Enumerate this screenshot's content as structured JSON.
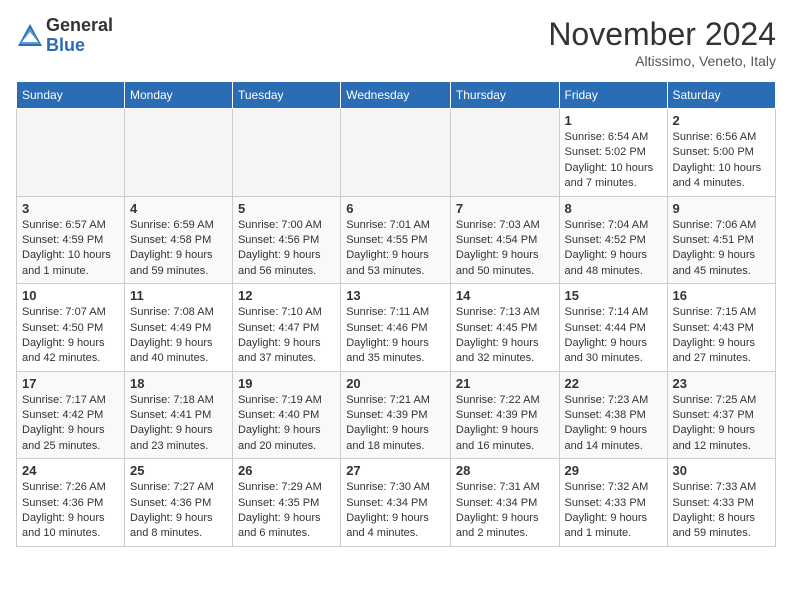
{
  "header": {
    "logo_line1": "General",
    "logo_line2": "Blue",
    "month_title": "November 2024",
    "subtitle": "Altissimo, Veneto, Italy"
  },
  "weekdays": [
    "Sunday",
    "Monday",
    "Tuesday",
    "Wednesday",
    "Thursday",
    "Friday",
    "Saturday"
  ],
  "weeks": [
    [
      {
        "day": "",
        "info": ""
      },
      {
        "day": "",
        "info": ""
      },
      {
        "day": "",
        "info": ""
      },
      {
        "day": "",
        "info": ""
      },
      {
        "day": "",
        "info": ""
      },
      {
        "day": "1",
        "info": "Sunrise: 6:54 AM\nSunset: 5:02 PM\nDaylight: 10 hours and 7 minutes."
      },
      {
        "day": "2",
        "info": "Sunrise: 6:56 AM\nSunset: 5:00 PM\nDaylight: 10 hours and 4 minutes."
      }
    ],
    [
      {
        "day": "3",
        "info": "Sunrise: 6:57 AM\nSunset: 4:59 PM\nDaylight: 10 hours and 1 minute."
      },
      {
        "day": "4",
        "info": "Sunrise: 6:59 AM\nSunset: 4:58 PM\nDaylight: 9 hours and 59 minutes."
      },
      {
        "day": "5",
        "info": "Sunrise: 7:00 AM\nSunset: 4:56 PM\nDaylight: 9 hours and 56 minutes."
      },
      {
        "day": "6",
        "info": "Sunrise: 7:01 AM\nSunset: 4:55 PM\nDaylight: 9 hours and 53 minutes."
      },
      {
        "day": "7",
        "info": "Sunrise: 7:03 AM\nSunset: 4:54 PM\nDaylight: 9 hours and 50 minutes."
      },
      {
        "day": "8",
        "info": "Sunrise: 7:04 AM\nSunset: 4:52 PM\nDaylight: 9 hours and 48 minutes."
      },
      {
        "day": "9",
        "info": "Sunrise: 7:06 AM\nSunset: 4:51 PM\nDaylight: 9 hours and 45 minutes."
      }
    ],
    [
      {
        "day": "10",
        "info": "Sunrise: 7:07 AM\nSunset: 4:50 PM\nDaylight: 9 hours and 42 minutes."
      },
      {
        "day": "11",
        "info": "Sunrise: 7:08 AM\nSunset: 4:49 PM\nDaylight: 9 hours and 40 minutes."
      },
      {
        "day": "12",
        "info": "Sunrise: 7:10 AM\nSunset: 4:47 PM\nDaylight: 9 hours and 37 minutes."
      },
      {
        "day": "13",
        "info": "Sunrise: 7:11 AM\nSunset: 4:46 PM\nDaylight: 9 hours and 35 minutes."
      },
      {
        "day": "14",
        "info": "Sunrise: 7:13 AM\nSunset: 4:45 PM\nDaylight: 9 hours and 32 minutes."
      },
      {
        "day": "15",
        "info": "Sunrise: 7:14 AM\nSunset: 4:44 PM\nDaylight: 9 hours and 30 minutes."
      },
      {
        "day": "16",
        "info": "Sunrise: 7:15 AM\nSunset: 4:43 PM\nDaylight: 9 hours and 27 minutes."
      }
    ],
    [
      {
        "day": "17",
        "info": "Sunrise: 7:17 AM\nSunset: 4:42 PM\nDaylight: 9 hours and 25 minutes."
      },
      {
        "day": "18",
        "info": "Sunrise: 7:18 AM\nSunset: 4:41 PM\nDaylight: 9 hours and 23 minutes."
      },
      {
        "day": "19",
        "info": "Sunrise: 7:19 AM\nSunset: 4:40 PM\nDaylight: 9 hours and 20 minutes."
      },
      {
        "day": "20",
        "info": "Sunrise: 7:21 AM\nSunset: 4:39 PM\nDaylight: 9 hours and 18 minutes."
      },
      {
        "day": "21",
        "info": "Sunrise: 7:22 AM\nSunset: 4:39 PM\nDaylight: 9 hours and 16 minutes."
      },
      {
        "day": "22",
        "info": "Sunrise: 7:23 AM\nSunset: 4:38 PM\nDaylight: 9 hours and 14 minutes."
      },
      {
        "day": "23",
        "info": "Sunrise: 7:25 AM\nSunset: 4:37 PM\nDaylight: 9 hours and 12 minutes."
      }
    ],
    [
      {
        "day": "24",
        "info": "Sunrise: 7:26 AM\nSunset: 4:36 PM\nDaylight: 9 hours and 10 minutes."
      },
      {
        "day": "25",
        "info": "Sunrise: 7:27 AM\nSunset: 4:36 PM\nDaylight: 9 hours and 8 minutes."
      },
      {
        "day": "26",
        "info": "Sunrise: 7:29 AM\nSunset: 4:35 PM\nDaylight: 9 hours and 6 minutes."
      },
      {
        "day": "27",
        "info": "Sunrise: 7:30 AM\nSunset: 4:34 PM\nDaylight: 9 hours and 4 minutes."
      },
      {
        "day": "28",
        "info": "Sunrise: 7:31 AM\nSunset: 4:34 PM\nDaylight: 9 hours and 2 minutes."
      },
      {
        "day": "29",
        "info": "Sunrise: 7:32 AM\nSunset: 4:33 PM\nDaylight: 9 hours and 1 minute."
      },
      {
        "day": "30",
        "info": "Sunrise: 7:33 AM\nSunset: 4:33 PM\nDaylight: 8 hours and 59 minutes."
      }
    ]
  ]
}
